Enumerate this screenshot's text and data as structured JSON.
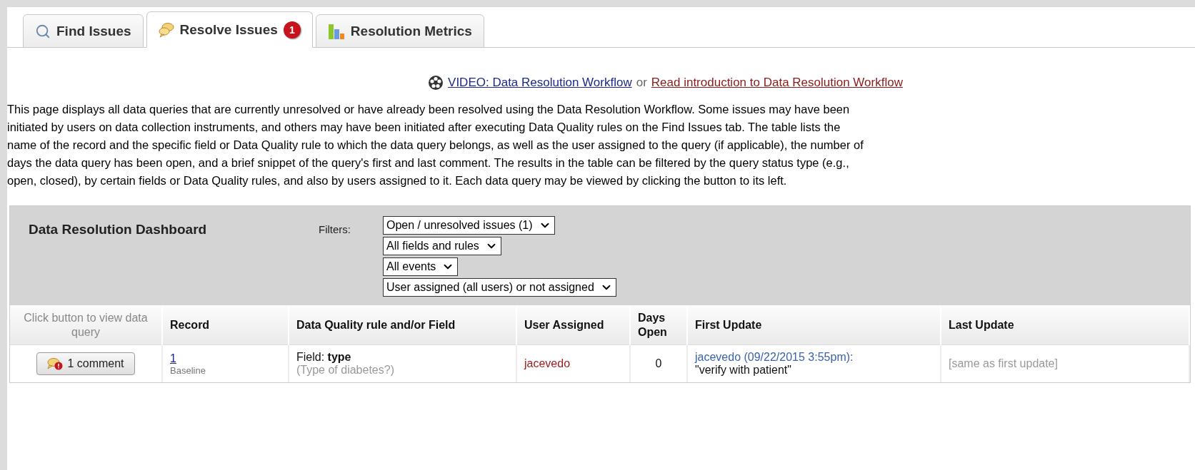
{
  "tabs": [
    {
      "label": "Find Issues",
      "selected": false,
      "kind": "search"
    },
    {
      "label": "Resolve Issues",
      "selected": true,
      "kind": "comments",
      "badge": "1"
    },
    {
      "label": "Resolution Metrics",
      "selected": false,
      "kind": "chart"
    }
  ],
  "intro": {
    "video_link": "VIDEO: Data Resolution Workflow",
    "separator": "or",
    "read_link": "Read introduction to Data Resolution Workflow"
  },
  "description": "This page displays all data queries that are currently unresolved or have already been resolved using the Data Resolution Workflow. Some issues may have been initiated by users on data collection instruments, and others may have been initiated after executing Data Quality rules on the Find Issues tab. The table lists the name of the record and the specific field or Data Quality rule to which the data query belongs, as well as the user assigned to the query (if applicable), the number of days the data query has been open, and a brief snippet of the query's first and last comment. The results in the table can be filtered by the query status type (e.g., open, closed), by certain fields or Data Quality rules, and also by users assigned to it. Each data query may be viewed by clicking the button to its left.",
  "dashboard": {
    "title": "Data Resolution Dashboard",
    "filters_label": "Filters:",
    "filters": [
      {
        "value": "Open / unresolved issues (1)"
      },
      {
        "value": "All fields and rules"
      },
      {
        "value": "All events"
      },
      {
        "value": "User assigned (all users) or not assigned"
      }
    ]
  },
  "table": {
    "columns": [
      "Click button to view data query",
      "Record",
      "Data Quality rule and/or Field",
      "User Assigned",
      "Days Open",
      "First Update",
      "Last Update"
    ],
    "rows": [
      {
        "button": "1 comment",
        "record": "1",
        "event": "Baseline",
        "field_prefix": "Field:",
        "field_name": "type",
        "field_label": "(Type of diabetes?)",
        "user": "jacevedo",
        "days_open": "0",
        "first_update_author": "jacevedo (09/22/2015 3:55pm):",
        "first_update_text": "\"verify with patient\"",
        "last_update": "[same as first update]"
      }
    ]
  }
}
